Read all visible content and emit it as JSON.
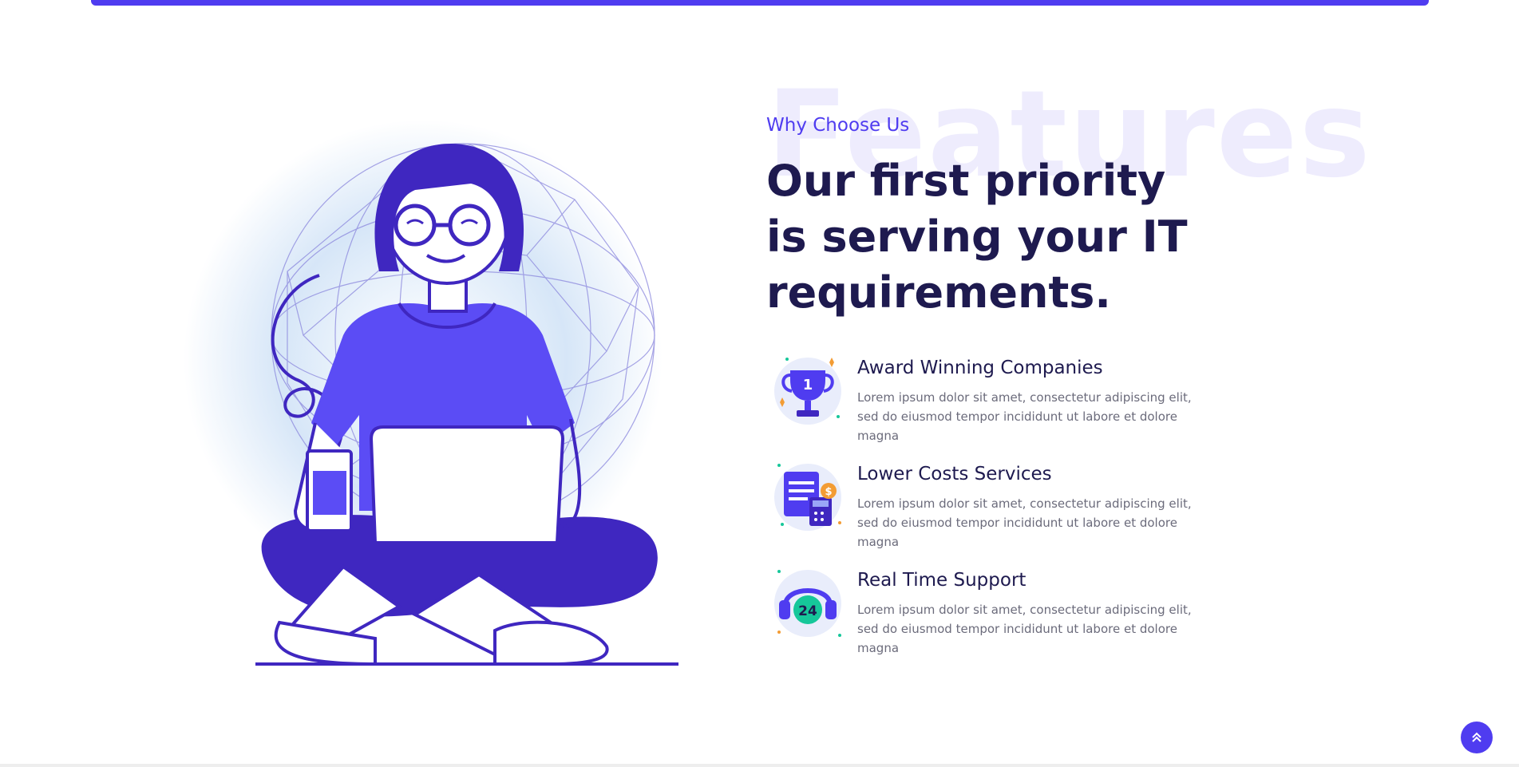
{
  "section": {
    "background_word": "Features",
    "eyebrow": "Why Choose Us",
    "headline": "Our first priority is serving your IT requirements."
  },
  "features": [
    {
      "icon": "trophy-icon",
      "title": "Award Winning Companies",
      "description": "Lorem ipsum dolor sit amet, consectetur adipiscing elit, sed do eiusmod tempor incididunt ut labore et dolore magna",
      "badge": "1"
    },
    {
      "icon": "invoice-calculator-icon",
      "title": "Lower Costs Services",
      "description": "Lorem ipsum dolor sit amet, consectetur adipiscing elit, sed do eiusmod tempor incididunt ut labore et dolore magna",
      "badge": "$"
    },
    {
      "icon": "headset-24-icon",
      "title": "Real Time Support",
      "description": "Lorem ipsum dolor sit amet, consectetur adipiscing elit, sed do eiusmod tempor incididunt ut labore et dolore magna",
      "badge": "24"
    }
  ],
  "colors": {
    "primary": "#4f3cf0",
    "dark_purple": "#3f27c0",
    "heading": "#1e1a4f",
    "text": "#6b6b7b",
    "accent_green": "#16c79a",
    "accent_orange": "#f39c34"
  },
  "scroll_top": {
    "icon": "double-chevron-up-icon"
  }
}
